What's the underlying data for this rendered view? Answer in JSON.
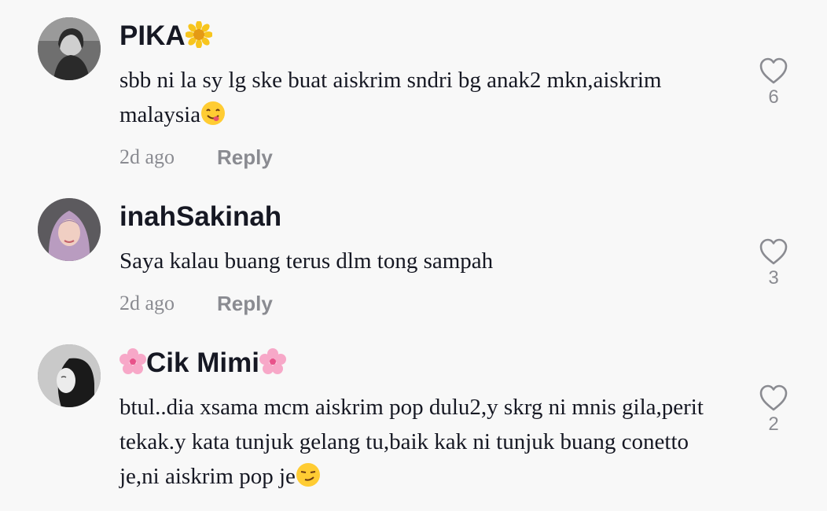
{
  "comments": [
    {
      "username": "PIKA",
      "text": "sbb ni la sy lg ske buat aiskrim sndri bg anak2 mkn,aiskrim malaysia",
      "time": "2d ago",
      "reply": "Reply",
      "likes": "6",
      "avatar_icon": "user-avatar",
      "name_emoji": "sunflower-icon",
      "text_emoji": "yum-face-icon"
    },
    {
      "username": "inahSakinah",
      "text": "Saya kalau buang terus dlm tong sampah",
      "time": "2d ago",
      "reply": "Reply",
      "likes": "3",
      "avatar_icon": "user-avatar"
    },
    {
      "username": "Cik Mimi",
      "text": "btul..dia xsama mcm aiskrim pop dulu2,y skrg ni mnis gila,perit tekak.y kata tunjuk gelang tu,baik kak ni tunjuk buang conetto je,ni aiskrim pop je",
      "likes": "2",
      "avatar_icon": "user-avatar",
      "name_emoji": "cherry-blossom-icon",
      "text_emoji": "smirk-face-icon"
    }
  ],
  "colors": {
    "background": "#f8f8f8",
    "text": "#161823",
    "muted": "#8a8b91"
  }
}
